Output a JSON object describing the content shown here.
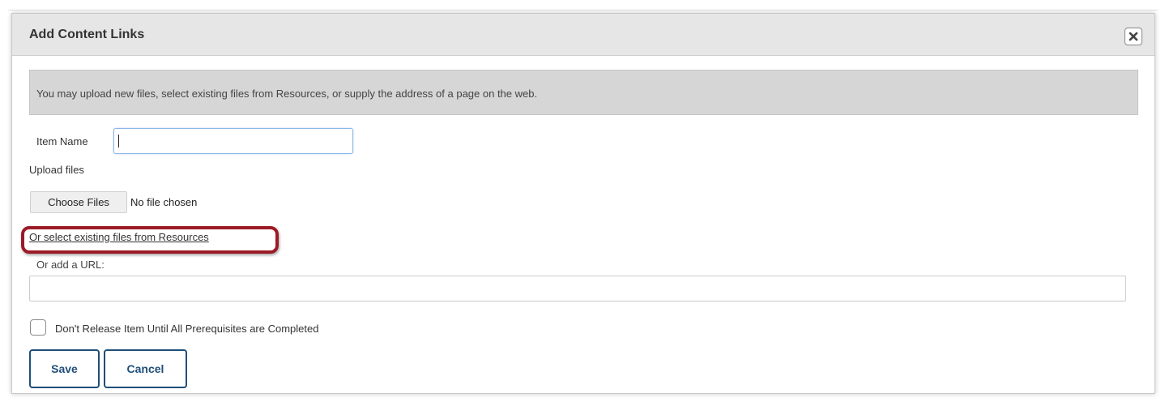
{
  "dialog": {
    "title": "Add Content Links",
    "close_icon": "close-icon"
  },
  "info": {
    "text": "You may upload new files, select existing files from Resources, or supply the address of a page on the web."
  },
  "form": {
    "item_name_label": "Item Name",
    "item_name_value": "",
    "upload_label": "Upload files",
    "choose_files_label": "Choose Files",
    "no_file_text": "No file chosen",
    "resources_link": "Or select existing files from Resources",
    "url_label": "Or add a URL:",
    "url_value": "",
    "prerequisite_label": "Don't Release Item Until All Prerequisites are Completed",
    "prerequisite_checked": false
  },
  "buttons": {
    "save": "Save",
    "cancel": "Cancel"
  },
  "colors": {
    "highlight": "#9b1b26",
    "button_text": "#1f4e79",
    "info_background": "#d6d6d6",
    "titlebar_background": "#e6e6e6"
  }
}
